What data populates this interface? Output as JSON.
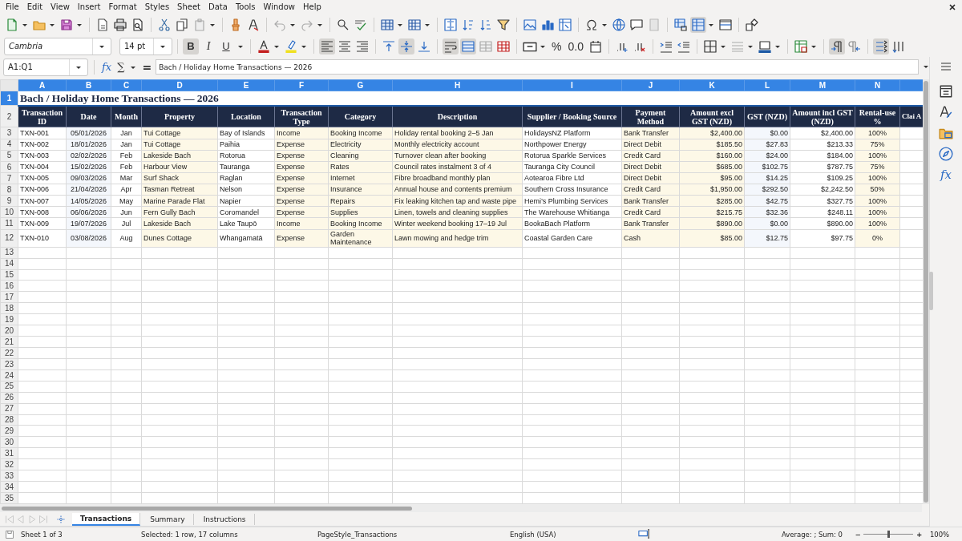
{
  "menu": [
    "File",
    "Edit",
    "View",
    "Insert",
    "Format",
    "Styles",
    "Sheet",
    "Data",
    "Tools",
    "Window",
    "Help"
  ],
  "font_name": "Cambria",
  "font_size": "14 pt",
  "text_style": [
    {
      "label": "B",
      "selected": true
    },
    {
      "label": "I",
      "selected": false
    },
    {
      "label": "U",
      "selected": false
    }
  ],
  "horizontal_align": [
    {
      "selected": true
    },
    {
      "selected": false
    },
    {
      "selected": false
    }
  ],
  "vertical_align": [
    {
      "selected": false
    },
    {
      "selected": true
    },
    {
      "selected": false
    }
  ],
  "wrap_text": {
    "selected": true
  },
  "merge": [
    {
      "selected": true
    },
    {
      "selected": false
    },
    {
      "selected": false
    }
  ],
  "number_formats": [
    "%",
    "0.0"
  ],
  "text_direction": [
    {
      "selected": true
    },
    {
      "selected": false
    }
  ],
  "text_flow": [
    {
      "selected": true
    },
    {
      "selected": false
    }
  ],
  "formula_bar": {
    "name_box": "A1:Q1",
    "function_wizard": "fx",
    "sum": "∑",
    "equals": "=",
    "formula": "Bach / Holiday Home Transactions — 2026"
  },
  "sidebar": {
    "functions": "fx"
  },
  "sheet": {
    "columns": [
      {
        "letter": "A",
        "selected": true
      },
      {
        "letter": "B",
        "selected": true
      },
      {
        "letter": "C",
        "selected": true
      },
      {
        "letter": "D",
        "selected": true
      },
      {
        "letter": "E",
        "selected": true
      },
      {
        "letter": "F",
        "selected": true
      },
      {
        "letter": "G",
        "selected": true
      },
      {
        "letter": "H",
        "selected": true
      },
      {
        "letter": "I",
        "selected": true
      },
      {
        "letter": "J",
        "selected": true
      },
      {
        "letter": "K",
        "selected": true
      },
      {
        "letter": "L",
        "selected": true
      },
      {
        "letter": "M",
        "selected": true
      },
      {
        "letter": "N",
        "selected": true
      }
    ],
    "title_row": {
      "number": "1",
      "selected": true,
      "title": "Bach / Holiday Home Transactions — 2026"
    },
    "header_row": {
      "number": "2",
      "selected": false,
      "cells": [
        "Transaction ID",
        "Date",
        "Month",
        "Property",
        "Location",
        "Transaction Type",
        "Category",
        "Description",
        "Supplier / Booking Source",
        "Payment Method",
        "Amount excl GST (NZD)",
        "GST (NZD)",
        "Amount incl GST (NZD)",
        "Rental-use %",
        "Clai A"
      ]
    },
    "rows": [
      {
        "number": "3",
        "selected": false,
        "cells": [
          "TXN-001",
          "05/01/2026",
          "Jan",
          "Tui Cottage",
          "Bay of Islands",
          "Income",
          "Booking Income",
          "Holiday rental booking 2–5 Jan",
          "HolidaysNZ Platform",
          "Bank Transfer",
          "$2,400.00",
          "$0.00",
          "$2,400.00",
          "100%"
        ]
      },
      {
        "number": "4",
        "selected": false,
        "cells": [
          "TXN-002",
          "18/01/2026",
          "Jan",
          "Tui Cottage",
          "Paihia",
          "Expense",
          "Electricity",
          "Monthly electricity account",
          "Northpower Energy",
          "Direct Debit",
          "$185.50",
          "$27.83",
          "$213.33",
          "75%"
        ]
      },
      {
        "number": "5",
        "selected": false,
        "cells": [
          "TXN-003",
          "02/02/2026",
          "Feb",
          "Lakeside Bach",
          "Rotorua",
          "Expense",
          "Cleaning",
          "Turnover clean after booking",
          "Rotorua Sparkle Services",
          "Credit Card",
          "$160.00",
          "$24.00",
          "$184.00",
          "100%"
        ]
      },
      {
        "number": "6",
        "selected": false,
        "cells": [
          "TXN-004",
          "15/02/2026",
          "Feb",
          "Harbour View",
          "Tauranga",
          "Expense",
          "Rates",
          "Council rates instalment 3 of 4",
          "Tauranga City Council",
          "Direct Debit",
          "$685.00",
          "$102.75",
          "$787.75",
          "75%"
        ]
      },
      {
        "number": "7",
        "selected": false,
        "cells": [
          "TXN-005",
          "09/03/2026",
          "Mar",
          "Surf Shack",
          "Raglan",
          "Expense",
          "Internet",
          "Fibre broadband monthly plan",
          "Aotearoa Fibre Ltd",
          "Direct Debit",
          "$95.00",
          "$14.25",
          "$109.25",
          "100%"
        ]
      },
      {
        "number": "8",
        "selected": false,
        "cells": [
          "TXN-006",
          "21/04/2026",
          "Apr",
          "Tasman Retreat",
          "Nelson",
          "Expense",
          "Insurance",
          "Annual house and contents premium",
          "Southern Cross Insurance",
          "Credit Card",
          "$1,950.00",
          "$292.50",
          "$2,242.50",
          "50%"
        ]
      },
      {
        "number": "9",
        "selected": false,
        "cells": [
          "TXN-007",
          "14/05/2026",
          "May",
          "Marine Parade Flat",
          "Napier",
          "Expense",
          "Repairs",
          "Fix leaking kitchen tap and waste pipe",
          "Hemi’s Plumbing Services",
          "Bank Transfer",
          "$285.00",
          "$42.75",
          "$327.75",
          "100%"
        ]
      },
      {
        "number": "10",
        "selected": false,
        "cells": [
          "TXN-008",
          "06/06/2026",
          "Jun",
          "Fern Gully Bach",
          "Coromandel",
          "Expense",
          "Supplies",
          "Linen, towels and cleaning supplies",
          "The Warehouse Whitianga",
          "Credit Card",
          "$215.75",
          "$32.36",
          "$248.11",
          "100%"
        ]
      },
      {
        "number": "11",
        "selected": false,
        "cells": [
          "TXN-009",
          "19/07/2026",
          "Jul",
          "Lakeside Bach",
          "Lake Taupō",
          "Income",
          "Booking Income",
          "Winter weekend booking 17–19 Jul",
          "BookaBach Platform",
          "Bank Transfer",
          "$890.00",
          "$0.00",
          "$890.00",
          "100%"
        ]
      },
      {
        "number": "12",
        "selected": false,
        "cells": [
          "TXN-010",
          "03/08/2026",
          "Aug",
          "Dunes Cottage",
          "Whangamatā",
          "Expense",
          "Garden Maintenance",
          "Lawn mowing and hedge trim",
          "Coastal Garden Care",
          "Cash",
          "$85.00",
          "$12.75",
          "$97.75",
          "0%"
        ]
      }
    ],
    "empty_rows": [
      "13",
      "14",
      "15",
      "16",
      "17",
      "18",
      "19",
      "20",
      "21",
      "22",
      "23",
      "24",
      "25",
      "26",
      "27",
      "28",
      "29",
      "30",
      "31",
      "32",
      "33",
      "34",
      "35"
    ]
  },
  "tabs": [
    {
      "label": "Transactions",
      "selected": true
    },
    {
      "label": "Summary",
      "selected": false
    },
    {
      "label": "Instructions",
      "selected": false
    }
  ],
  "status_bar": {
    "sheet": "Sheet 1 of 3",
    "selection": "Selected: 1 row, 17 columns",
    "page_style": "PageStyle_Transactions",
    "language": "English (USA)",
    "summary": "Average: ; Sum: 0",
    "zoom_out": "−",
    "zoom_in": "+",
    "zoom_slider": {
      "level": 0.5
    },
    "zoom": "100%"
  }
}
